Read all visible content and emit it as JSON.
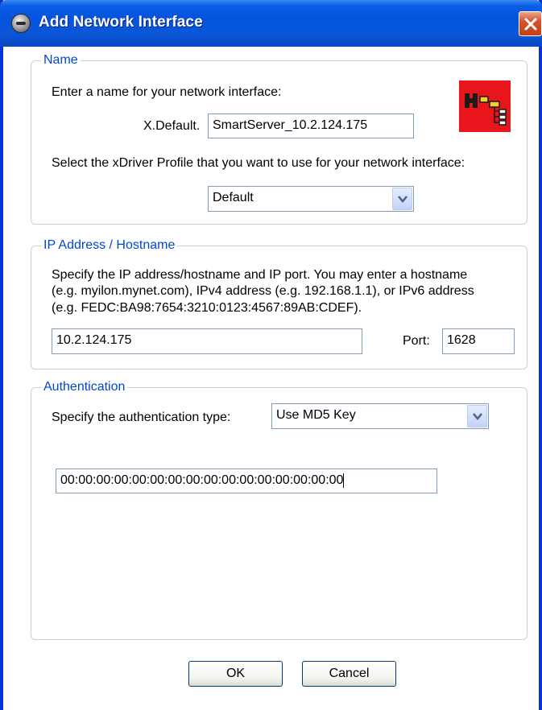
{
  "window": {
    "title": "Add Network Interface",
    "icon": "network-globe-icon",
    "accent_color": "#0A5EE4",
    "close_icon": "close-icon"
  },
  "name_group": {
    "legend": "Name",
    "prompt": "Enter a name for your network interface:",
    "prefix_label": "X.Default.",
    "name_value": "SmartServer_10.2.124.175",
    "profile_prompt": "Select the xDriver Profile that you want to use for your network interface:",
    "profile_value": "Default",
    "logo_icon": "xdriver-logo-icon"
  },
  "ip_group": {
    "legend": "IP Address / Hostname",
    "description_line1": "Specify the IP address/hostname and IP port.  You may enter a hostname",
    "description_line2": "(e.g. myilon.mynet.com), IPv4 address (e.g. 192.168.1.1), or IPv6 address",
    "description_line3": "(e.g. FEDC:BA98:7654:3210:0123:4567:89AB:CDEF).",
    "address_value": "10.2.124.175",
    "port_label": "Port:",
    "port_value": "1628"
  },
  "auth_group": {
    "legend": "Authentication",
    "type_label": "Specify the authentication type:",
    "type_value": "Use MD5 Key",
    "key_value": "00:00:00:00:00:00:00:00:00:00:00:00:00:00:00:00"
  },
  "buttons": {
    "ok_label": "OK",
    "cancel_label": "Cancel"
  }
}
